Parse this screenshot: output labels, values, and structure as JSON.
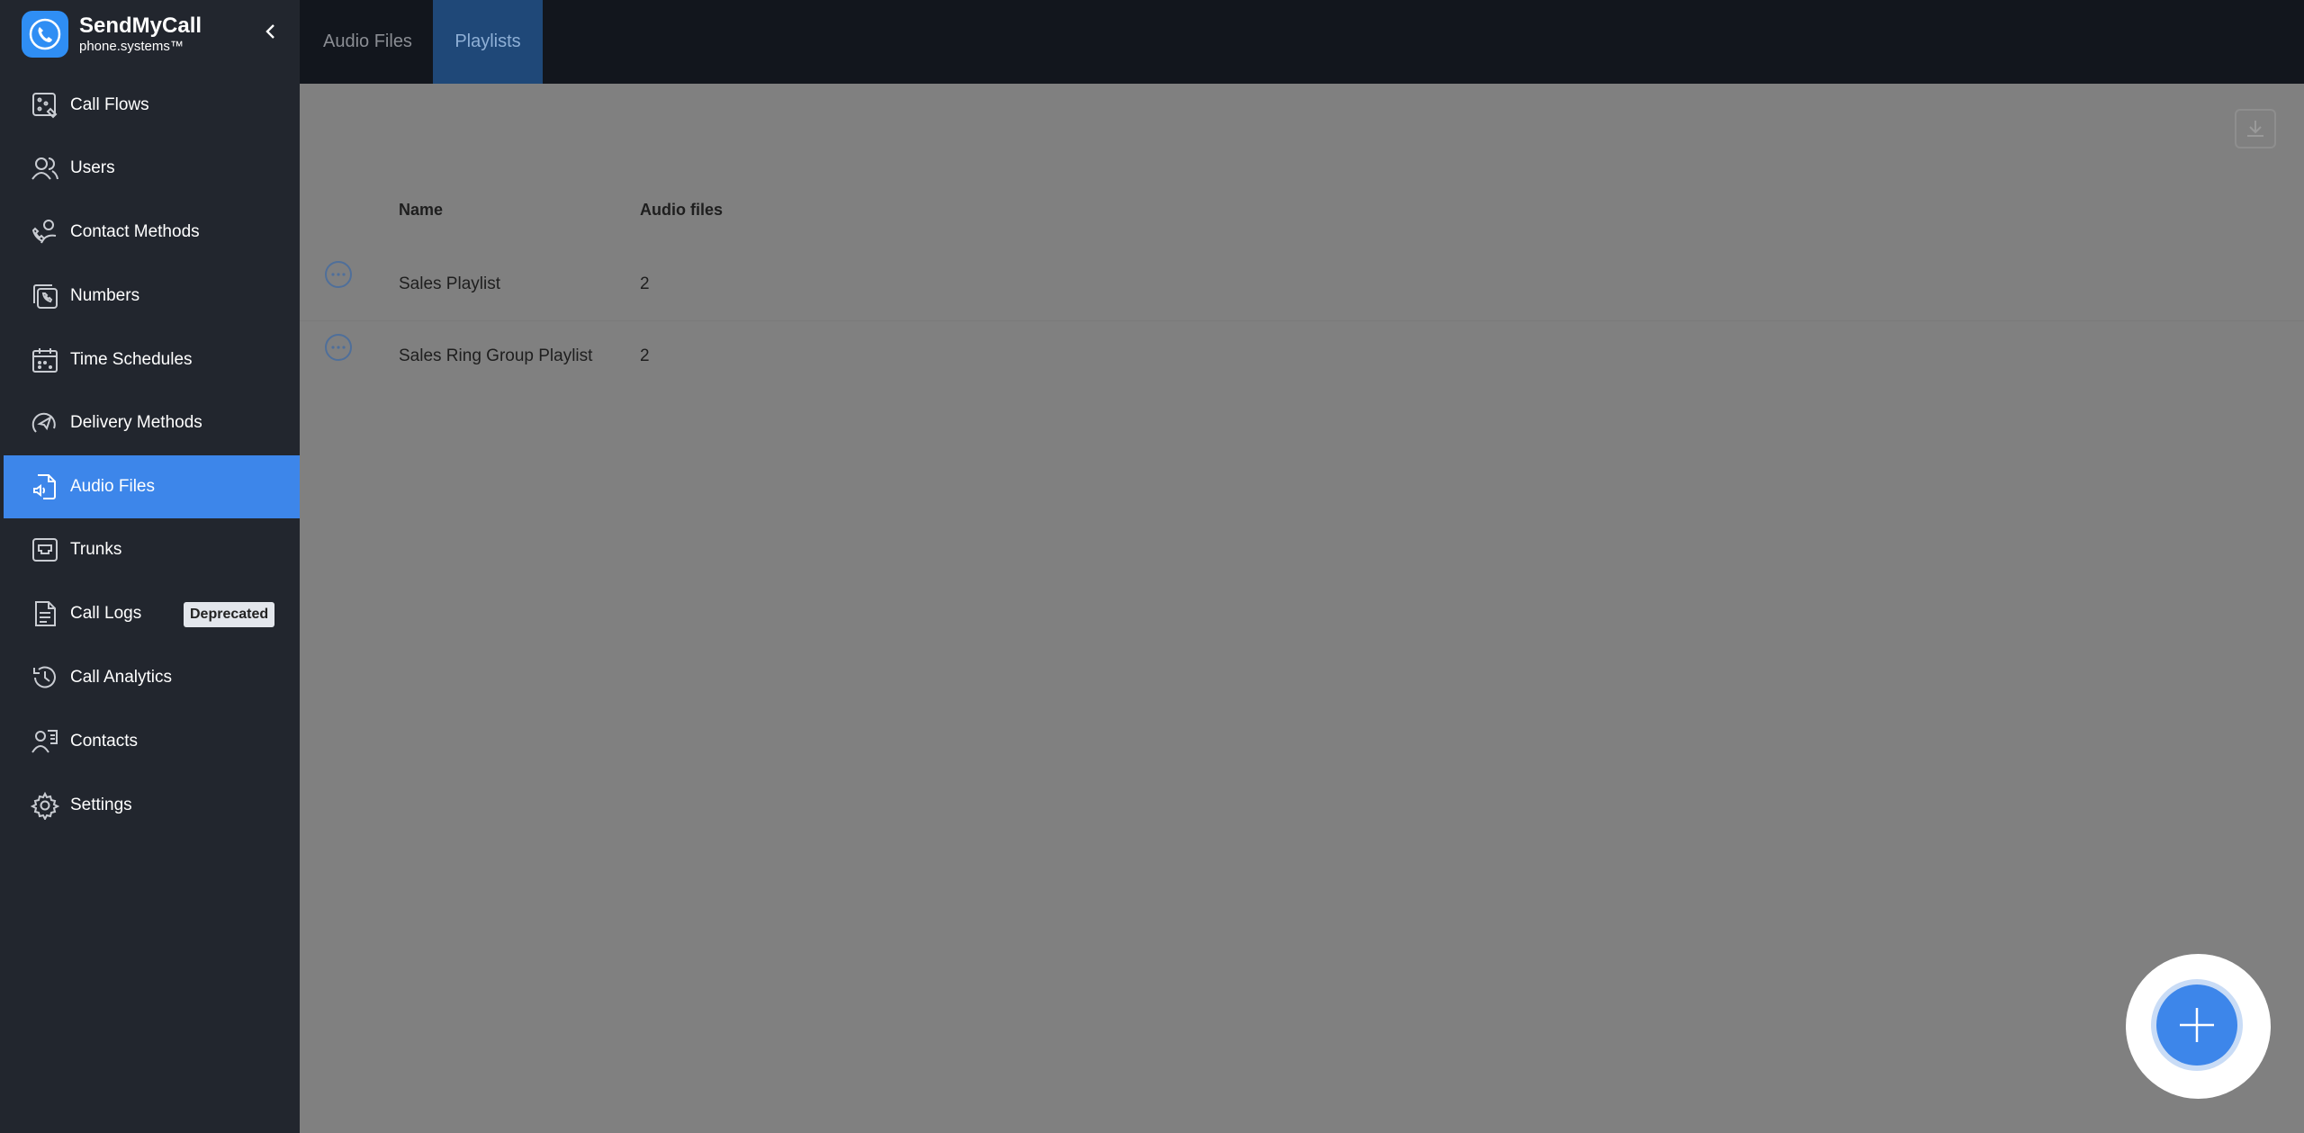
{
  "brand": {
    "name": "SendMyCall",
    "subtitle": "phone.systems™"
  },
  "sidebar": {
    "items": [
      {
        "label": "Call Flows",
        "icon": "call-flows-icon"
      },
      {
        "label": "Users",
        "icon": "users-icon"
      },
      {
        "label": "Contact Methods",
        "icon": "contact-methods-icon"
      },
      {
        "label": "Numbers",
        "icon": "numbers-icon"
      },
      {
        "label": "Time Schedules",
        "icon": "calendar-icon"
      },
      {
        "label": "Delivery Methods",
        "icon": "send-icon"
      },
      {
        "label": "Audio Files",
        "icon": "audio-file-icon",
        "active": true
      },
      {
        "label": "Trunks",
        "icon": "trunk-icon"
      },
      {
        "label": "Call Logs",
        "icon": "document-icon",
        "badge": "Deprecated"
      },
      {
        "label": "Call Analytics",
        "icon": "history-icon"
      },
      {
        "label": "Contacts",
        "icon": "contacts-icon"
      },
      {
        "label": "Settings",
        "icon": "gear-icon"
      }
    ]
  },
  "tabs": [
    {
      "label": "Audio Files",
      "active": false
    },
    {
      "label": "Playlists",
      "active": true
    }
  ],
  "table": {
    "headers": {
      "name": "Name",
      "audio_files": "Audio files"
    },
    "rows": [
      {
        "name": "Sales Playlist",
        "audio_files": "2"
      },
      {
        "name": "Sales Ring Group Playlist",
        "audio_files": "2"
      }
    ]
  },
  "colors": {
    "accent": "#3d86ea",
    "sidebar_bg": "#22262e",
    "topbar_bg": "#12161d",
    "overlay": "#808080"
  }
}
